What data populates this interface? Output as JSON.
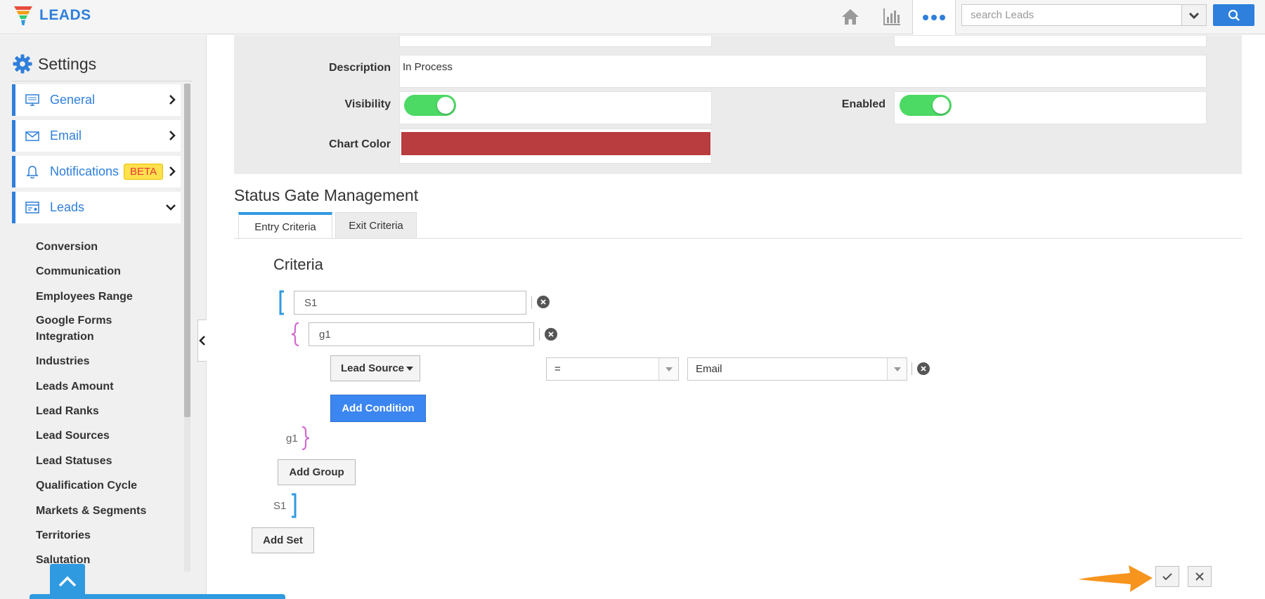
{
  "app": {
    "brand": "LEADS"
  },
  "search": {
    "placeholder": "search Leads"
  },
  "sidebar": {
    "title": "Settings",
    "items": [
      {
        "label": "General"
      },
      {
        "label": "Email"
      },
      {
        "label": "Notifications",
        "badge": "BETA"
      },
      {
        "label": "Leads"
      }
    ],
    "sub_items": [
      "Conversion",
      "Communication",
      "Employees Range",
      "Google Forms",
      "Integration",
      "Industries",
      "Leads Amount",
      "Lead Ranks",
      "Lead Sources",
      "Lead Statuses",
      "Qualification Cycle",
      "Markets & Segments",
      "Territories",
      "Salutation"
    ]
  },
  "form": {
    "description_label": "Description",
    "description_value": "In Process",
    "visibility_label": "Visibility",
    "enabled_label": "Enabled",
    "chart_color_label": "Chart Color",
    "chart_color": "#b93c3e",
    "visibility_on": true,
    "enabled_on": true
  },
  "gate": {
    "title": "Status Gate Management",
    "tabs": [
      {
        "label": "Entry Criteria"
      },
      {
        "label": "Exit Criteria"
      }
    ],
    "criteria_title": "Criteria",
    "set_name": "S1",
    "group_name": "g1",
    "condition": {
      "field": "Lead Source",
      "operator": "=",
      "value": "Email"
    },
    "add_condition_label": "Add Condition",
    "add_group_label": "Add Group",
    "add_set_label": "Add Set",
    "group_end_label": "g1",
    "set_end_label": "S1"
  },
  "colors": {
    "accent": "#2f7fdc",
    "toggle_on": "#4cd964",
    "hint_arrow": "#f7941d"
  }
}
